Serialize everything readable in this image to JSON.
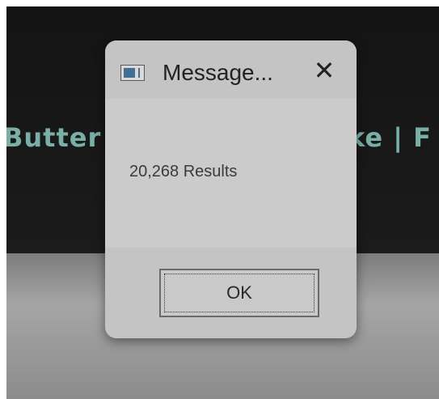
{
  "background": {
    "text_left": "Butter C",
    "text_right": "ke | F"
  },
  "dialog": {
    "title": "Message...",
    "close_glyph": "✕",
    "message": "20,268 Results",
    "ok_label": "OK",
    "app_icon": "window-icon"
  },
  "colors": {
    "dialog_bg": "#c9c9c9",
    "background_text": "#78b0a8",
    "backdrop": "#141414"
  }
}
